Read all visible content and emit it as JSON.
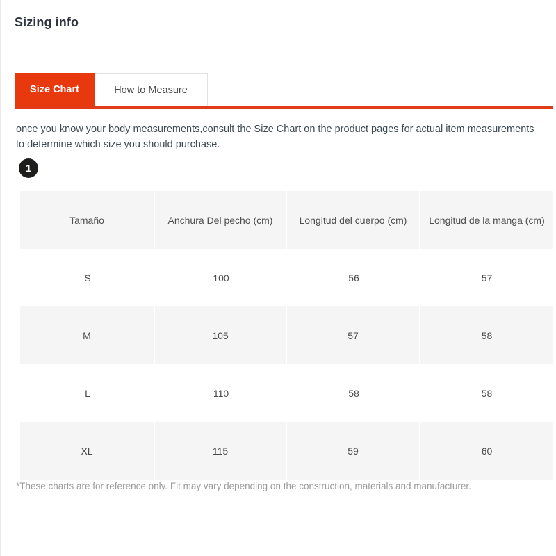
{
  "page_title": "Sizing info",
  "tabs": [
    {
      "label": "Size Chart",
      "active": true
    },
    {
      "label": "How to Measure",
      "active": false
    }
  ],
  "intro_text": "once you know your body measurements,consult the Size Chart on the product pages for actual item measurements to determine which size you should purchase.",
  "step_badge": "1",
  "footnote": "*These charts are for reference only. Fit may vary depending on the construction, materials and manufacturer.",
  "colors": {
    "accent_red": "#e8380d",
    "rule_red": "#e03a16",
    "title": "#2f3640",
    "row_shaded": "#f5f5f5",
    "badge_bg": "#1d1d1b"
  },
  "chart_data": {
    "type": "table",
    "title": "Size Chart",
    "columns": [
      "Tamaño",
      "Anchura Del pecho (cm)",
      "Longitud del cuerpo (cm)",
      "Longitud de la manga (cm)"
    ],
    "rows": [
      [
        "S",
        "100",
        "56",
        "57"
      ],
      [
        "M",
        "105",
        "57",
        "58"
      ],
      [
        "L",
        "110",
        "58",
        "58"
      ],
      [
        "XL",
        "115",
        "59",
        "60"
      ]
    ]
  }
}
